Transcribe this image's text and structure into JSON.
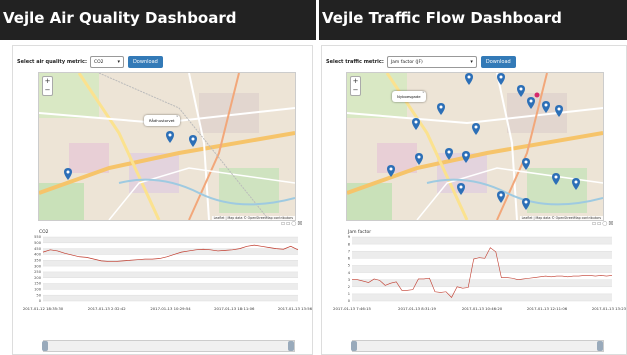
{
  "air": {
    "title": "Vejle Air Quality Dashboard",
    "metric_label": "Select air quality metric:",
    "metric_value": "CO2",
    "download_label": "Download",
    "popup_label": "Rådhustorvet",
    "attribution": "Leaflet | Map data © OpenStreetMap contributors",
    "chart_data": {
      "type": "line",
      "title": "CO2",
      "ylim": [
        0,
        550
      ],
      "yticks": [
        "0",
        "50",
        "100",
        "150",
        "200",
        "250",
        "300",
        "350",
        "400",
        "450",
        "500",
        "550"
      ],
      "xticks": [
        "2017-01-12 18:35:30",
        "2017-01-13 2:32:42",
        "2017-01-13 10:29:54",
        "2017-01-13 18:11:06",
        "2017-01-13 13:56:28"
      ],
      "series": [
        {
          "values": [
            420,
            440,
            430,
            410,
            395,
            380,
            375,
            360,
            345,
            340,
            340,
            345,
            350,
            355,
            360,
            360,
            365,
            380,
            400,
            420,
            430,
            440,
            445,
            440,
            430,
            435,
            440,
            450,
            470,
            480,
            470,
            460,
            450,
            445,
            470,
            440
          ]
        }
      ]
    }
  },
  "traffic": {
    "title": "Vejle Traffic Flow Dashboard",
    "metric_label": "Select traffic metric:",
    "metric_value": "Jam factor (JF)",
    "download_label": "Download",
    "popup_label": "Nyboesgade",
    "attribution": "Leaflet | Map data © OpenStreetMap contributors",
    "chart_data": {
      "type": "line",
      "title": "Jam factor",
      "ylim": [
        0,
        9
      ],
      "yticks": [
        "0",
        "1",
        "2",
        "3",
        "4",
        "5",
        "6",
        "7",
        "8",
        "9"
      ],
      "xticks": [
        "2017-01-13 7:46:15",
        "2017-01-13 8:31:19",
        "2017-01-13 10:46:20",
        "2017-01-13 12:11:06",
        "2017-01-13 13:23:17"
      ],
      "series": [
        {
          "values": [
            3,
            3,
            2.8,
            2.6,
            3.1,
            2.9,
            2.2,
            2.5,
            2.7,
            1.5,
            1.5,
            1.6,
            3.1,
            3.1,
            3.2,
            1.3,
            1.2,
            1.3,
            0.5,
            2.0,
            1.8,
            1.9,
            5.9,
            6.1,
            6.0,
            7.5,
            6.9,
            3.3,
            3.3,
            3.2,
            3.0,
            3.1,
            3.2,
            3.3,
            3.4,
            3.5,
            3.4,
            3.5,
            3.5,
            3.4,
            3.5,
            3.5,
            3.6,
            3.6,
            3.5,
            3.6,
            3.5,
            3.6
          ]
        }
      ]
    }
  },
  "icons": {
    "chart_tools": [
      "save-icon",
      "print-icon",
      "reset-icon",
      "close-icon"
    ]
  },
  "colors": {
    "line": "#c0392b",
    "marker": "#2c6fb7",
    "button": "#337ab7"
  }
}
